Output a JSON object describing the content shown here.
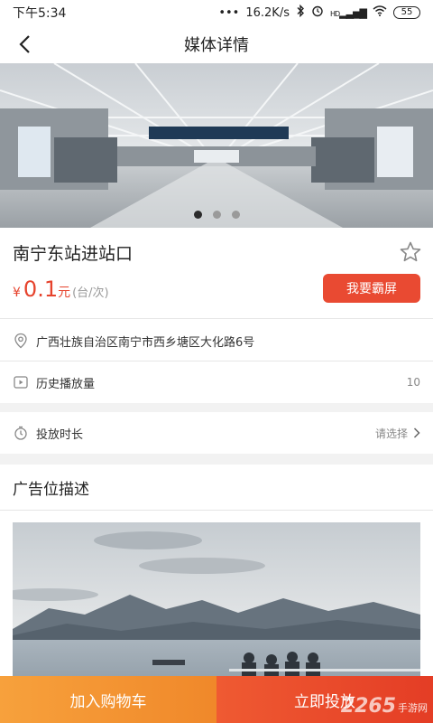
{
  "status_bar": {
    "time": "下午5:34",
    "network_speed": "16.2K/s",
    "battery": "55",
    "signal": "HD"
  },
  "header": {
    "title": "媒体详情"
  },
  "banner": {
    "slide_count": 3,
    "active_index": 0
  },
  "media": {
    "name": "南宁东站进站口",
    "currency": "¥",
    "price": "0.1",
    "price_unit": "元",
    "price_per": "(台/次)",
    "bully_button": "我要霸屏"
  },
  "info": {
    "address": "广西壮族自治区南宁市西乡塘区大化路6号",
    "play_count_label": "历史播放量",
    "play_count_value": "10",
    "duration_label": "投放时长",
    "duration_value": "请选择"
  },
  "section": {
    "description_title": "广告位描述"
  },
  "bottom": {
    "cart_label": "加入购物车",
    "launch_label": "立即投放"
  },
  "watermark": {
    "number": "2265",
    "text": "手游网"
  },
  "colors": {
    "accent_red": "#e94a32",
    "accent_orange": "#f7a13c"
  }
}
